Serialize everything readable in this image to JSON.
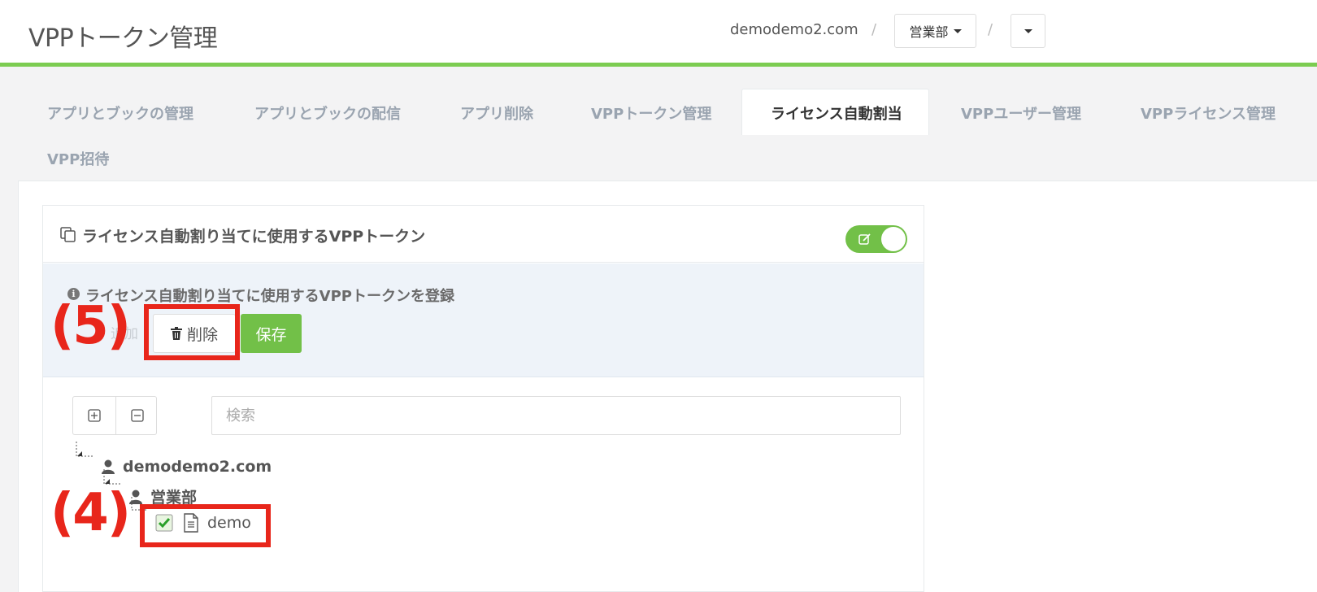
{
  "header": {
    "title": "VPPトークン管理",
    "breadcrumb_domain": "demodemo2.com",
    "separator": "/",
    "dept_dropdown_label": "営業部",
    "accent_color": "#7ccc51"
  },
  "tabs": [
    {
      "label": "アプリとブックの管理"
    },
    {
      "label": "アプリとブックの配信"
    },
    {
      "label": "アプリ削除"
    },
    {
      "label": "VPPトークン管理"
    },
    {
      "label": "ライセンス自動割当",
      "active": true
    },
    {
      "label": "VPPユーザー管理"
    },
    {
      "label": "VPPライセンス管理"
    },
    {
      "label": "VPP招待"
    }
  ],
  "panel": {
    "title": "ライセンス自動割り当てに使用するVPPトークン",
    "toggle_state": "on",
    "info_text": "ライセンス自動割り当てに使用するVPPトークンを登録",
    "partially_hidden_button": "追加",
    "delete_label": "削除",
    "save_label": "保存",
    "search_placeholder": "検索"
  },
  "tree": {
    "root": {
      "label": "demodemo2.com",
      "icon": "user-icon"
    },
    "child": {
      "label": "営業部",
      "icon": "user-icon"
    },
    "leaf": {
      "label": "demo",
      "icon": "file-icon",
      "checked": true
    }
  },
  "annotations": {
    "five": "(5)",
    "four": "(4)",
    "color": "#e8261b"
  }
}
